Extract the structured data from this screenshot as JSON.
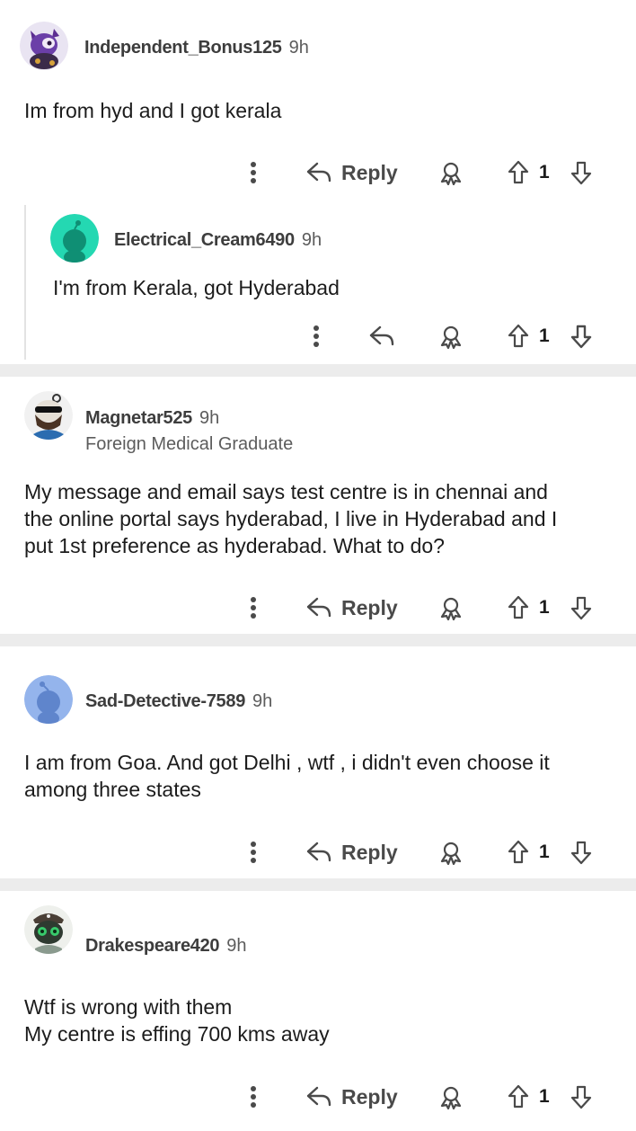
{
  "comments": [
    {
      "username": "Independent_Bonus125",
      "time": "9h",
      "flair": "",
      "lines": [
        "Im from hyd and I got kerala"
      ],
      "reply_label": "Reply",
      "votes": "1",
      "avatar_icon": "purple-character-avatar"
    },
    {
      "username": "Electrical_Cream6490",
      "time": "9h",
      "flair": "",
      "lines": [
        "I'm from Kerala, got Hyderabad"
      ],
      "reply_label": "",
      "votes": "1",
      "avatar_icon": "teal-snoo-avatar"
    },
    {
      "username": "Magnetar525",
      "time": "9h",
      "flair": "Foreign Medical Graduate",
      "lines": [
        "My message and email says test centre is in chennai and",
        "the online portal says hyderabad, I live in Hyderabad and I",
        "put 1st preference as hyderabad. What to do?"
      ],
      "reply_label": "Reply",
      "votes": "1",
      "avatar_icon": "bearded-sunglasses-avatar"
    },
    {
      "username": "Sad-Detective-7589",
      "time": "9h",
      "flair": "",
      "lines": [
        "I am from Goa. And got Delhi , wtf , i didn't even choose it",
        "among three states"
      ],
      "reply_label": "Reply",
      "votes": "1",
      "avatar_icon": "blue-snoo-avatar"
    },
    {
      "username": "Drakespeare420",
      "time": "9h",
      "flair": "",
      "lines": [
        "Wtf is wrong with them",
        "My centre is effing 700 kms away"
      ],
      "reply_label": "Reply",
      "votes": "1",
      "avatar_icon": "robot-pirate-avatar"
    }
  ],
  "colors": {
    "separator": "#ececec",
    "icon": "#4a4a4a",
    "text": "#1c1c1c",
    "meta": "#5c5c5c"
  }
}
